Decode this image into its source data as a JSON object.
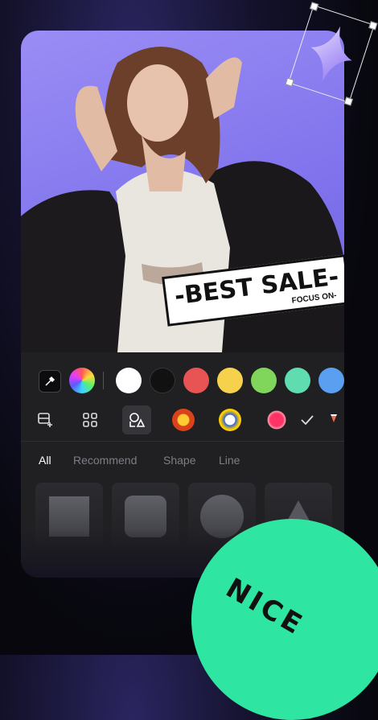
{
  "sticker": {
    "main_text": "-BEST SALE-",
    "sub_text": "FOCUS ON-"
  },
  "toolbar": {
    "colors": [
      "#ffffff",
      "#111111",
      "#e85454",
      "#f6d24c",
      "#7fd65a",
      "#5fdcb0",
      "#5a9ff0"
    ],
    "tabs": [
      {
        "label": "All",
        "active": true
      },
      {
        "label": "Recommend",
        "active": false
      },
      {
        "label": "Shape",
        "active": false
      },
      {
        "label": "Line",
        "active": false
      }
    ],
    "shapes": [
      "square",
      "rounded-square",
      "circle",
      "triangle"
    ]
  },
  "badge": {
    "text": "NICE",
    "color": "#2ee6a2"
  },
  "accent": "#7f72ec"
}
